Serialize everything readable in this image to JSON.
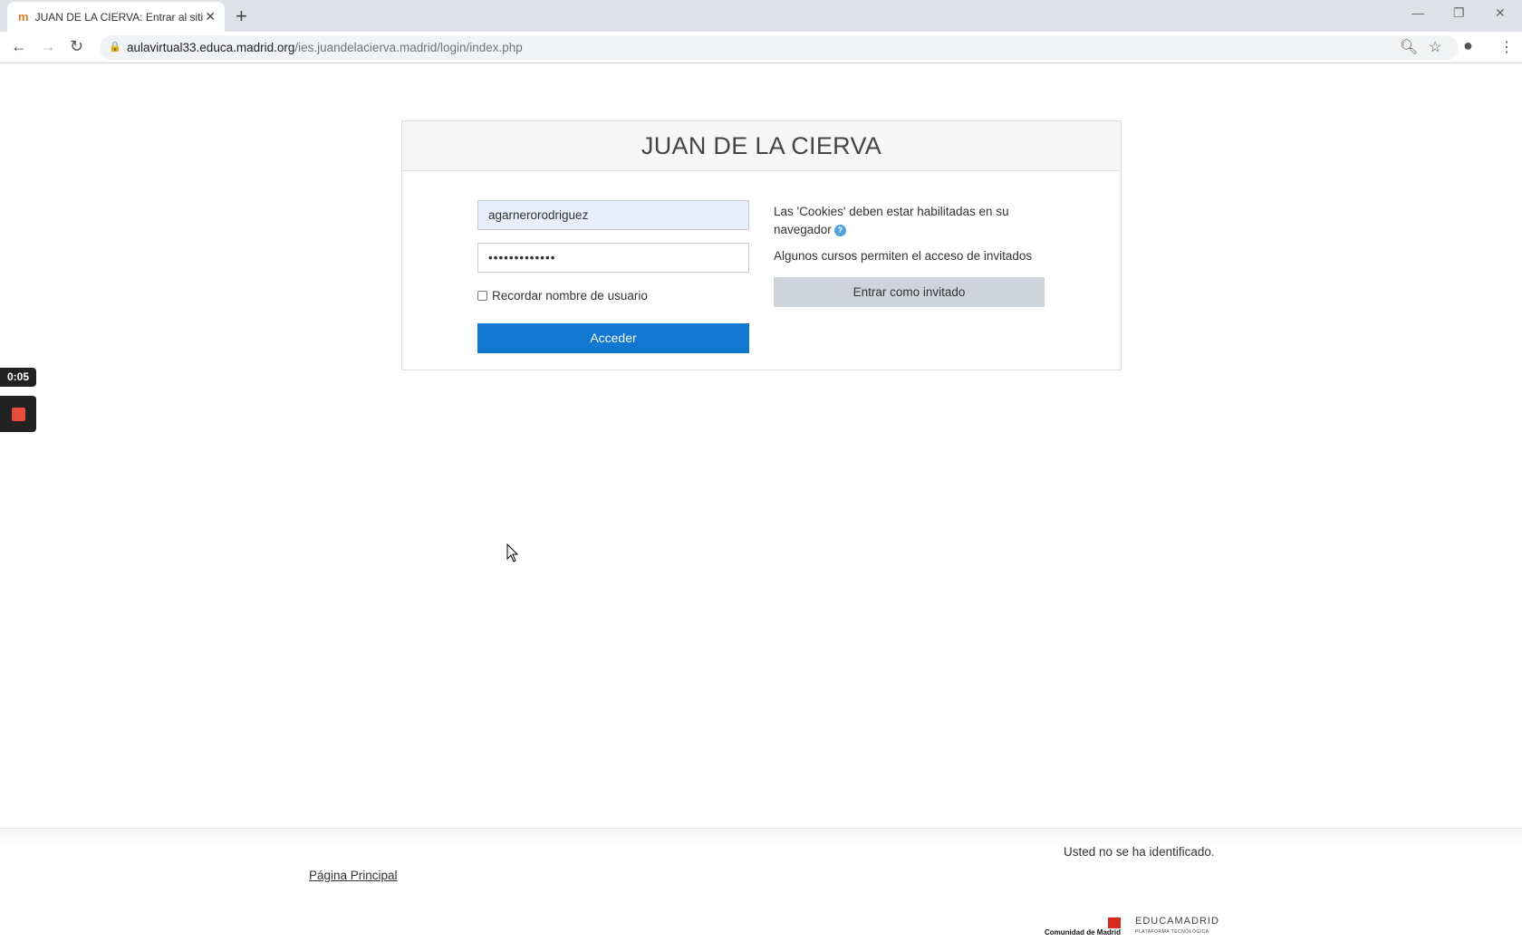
{
  "browser": {
    "tab_title": "JUAN DE LA CIERVA: Entrar al siti",
    "url_host": "aulavirtual33.educa.madrid.org",
    "url_path": "/ies.juandelacierva.madrid/login/index.php"
  },
  "page": {
    "site_title": "JUAN DE LA CIERVA",
    "username_value": "agarnerorodriguez",
    "password_value": "•••••••••••••",
    "remember_label": "Recordar nombre de usuario",
    "login_button": "Acceder",
    "cookies_text": "Las 'Cookies' deben estar habilitadas en su navegador",
    "guest_info": "Algunos cursos permiten el acceso de invitados",
    "guest_button": "Entrar como invitado"
  },
  "recorder": {
    "time": "0:05"
  },
  "footer": {
    "home_link": "Página Principal",
    "login_status": "Usted no se ha identificado.",
    "logo1": "Comunidad de Madrid",
    "logo2": "EDUCAMADRID",
    "logo2_sub": "PLATAFORMA TECNOLÓGICA"
  },
  "colors": {
    "primary": "#1177d1",
    "guest_button": "#ced4da"
  }
}
